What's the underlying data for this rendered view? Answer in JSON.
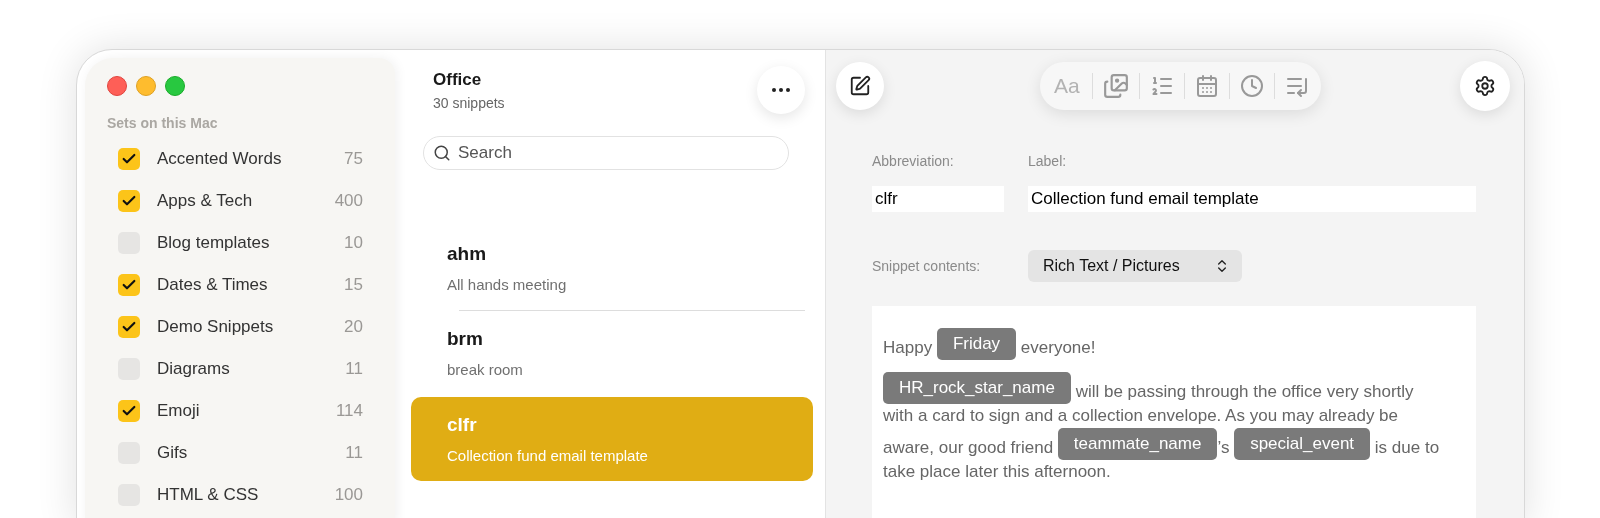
{
  "sidebar": {
    "section_title": "Sets on this Mac",
    "items": [
      {
        "label": "Accented Words",
        "count": "75",
        "checked": true
      },
      {
        "label": "Apps & Tech",
        "count": "400",
        "checked": true
      },
      {
        "label": "Blog templates",
        "count": "10",
        "checked": false
      },
      {
        "label": "Dates & Times",
        "count": "15",
        "checked": true
      },
      {
        "label": "Demo Snippets",
        "count": "20",
        "checked": true
      },
      {
        "label": "Diagrams",
        "count": "11",
        "checked": false
      },
      {
        "label": "Emoji",
        "count": "114",
        "checked": true
      },
      {
        "label": "Gifs",
        "count": "11",
        "checked": false
      },
      {
        "label": "HTML & CSS",
        "count": "100",
        "checked": false
      }
    ]
  },
  "list": {
    "title": "Office",
    "subtitle": "30 snippets",
    "search": {
      "placeholder": "Search"
    },
    "snippets": [
      {
        "abbreviation": "ahm",
        "label": "All hands meeting",
        "selected": false
      },
      {
        "abbreviation": "brm",
        "label": "break room",
        "selected": false
      },
      {
        "abbreviation": "clfr",
        "label": "Collection fund email template",
        "selected": true
      }
    ]
  },
  "editor": {
    "toolbar_font_label": "Aa",
    "abbreviation_label": "Abbreviation:",
    "abbreviation": "clfr",
    "label_label": "Label:",
    "label": "Collection fund email template",
    "contents_label": "Snippet contents:",
    "contents_type": "Rich Text / Pictures",
    "paragraphs": [
      [
        {
          "kind": "text",
          "text": "Happy "
        },
        {
          "kind": "token",
          "text": "Friday"
        },
        {
          "kind": "text",
          "text": " everyone!"
        }
      ],
      [
        {
          "kind": "token",
          "text": "HR_rock_star_name"
        },
        {
          "kind": "text",
          "text": " will be passing through the office very shortly with a card to sign and a collection envelope. As you may already be aware, our good friend "
        },
        {
          "kind": "token",
          "text": "teammate_name"
        },
        {
          "kind": "text",
          "text": "’s "
        },
        {
          "kind": "token",
          "text": "special_event"
        },
        {
          "kind": "text",
          "text": " is due to take place later this afternoon."
        }
      ]
    ]
  }
}
